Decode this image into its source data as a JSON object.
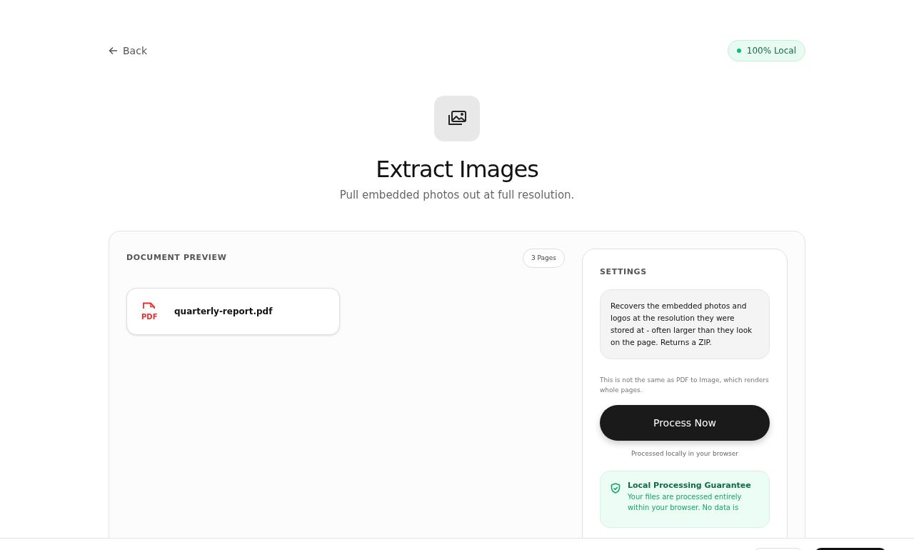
{
  "back": {
    "label": "Back"
  },
  "status_badge": {
    "label": "100% Local"
  },
  "header": {
    "title": "Extract Images",
    "subtitle": "Pull embedded photos out at full resolution."
  },
  "preview": {
    "heading": "DOCUMENT PREVIEW",
    "page_count": "3 Pages",
    "files": [
      {
        "name": "quarterly-report.pdf",
        "type_label": "PDF"
      }
    ]
  },
  "settings": {
    "heading": "SETTINGS",
    "description": "Recovers the embedded photos and logos at the resolution they were stored at - often larger than they look on the page. Returns a ZIP.",
    "note": "This is not the same as PDF to Image, which renders whole pages.",
    "button": "Process Now",
    "button_caption": "Processed locally in your browser",
    "guarantee": {
      "title": "Local Processing Guarantee",
      "lines": [
        "Your files are processed entirely",
        "within your browser. No data is"
      ]
    }
  }
}
